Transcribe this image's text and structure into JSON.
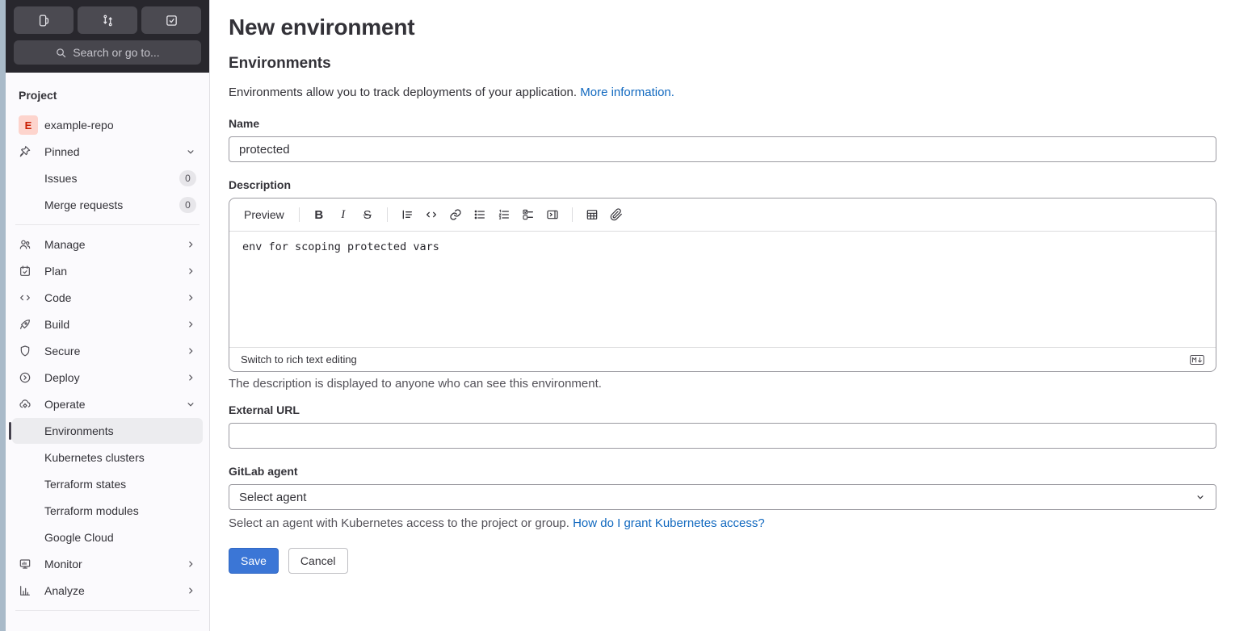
{
  "colors": {
    "accent_blue": "#3b76d6",
    "link_blue": "#1068bf"
  },
  "topbar": {
    "search_placeholder": "Search or go to..."
  },
  "sidebar": {
    "section_label": "Project",
    "project_initial": "E",
    "project_name": "example-repo",
    "pinned_label": "Pinned",
    "pinned_items": [
      {
        "label": "Issues",
        "badge": "0"
      },
      {
        "label": "Merge requests",
        "badge": "0"
      }
    ],
    "menu": [
      {
        "label": "Manage"
      },
      {
        "label": "Plan"
      },
      {
        "label": "Code"
      },
      {
        "label": "Build"
      },
      {
        "label": "Secure"
      },
      {
        "label": "Deploy"
      },
      {
        "label": "Operate"
      }
    ],
    "operate_children": [
      {
        "label": "Environments"
      },
      {
        "label": "Kubernetes clusters"
      },
      {
        "label": "Terraform states"
      },
      {
        "label": "Terraform modules"
      },
      {
        "label": "Google Cloud"
      }
    ],
    "after_operate": [
      {
        "label": "Monitor"
      },
      {
        "label": "Analyze"
      }
    ]
  },
  "main": {
    "title": "New environment",
    "heading": "Environments",
    "intro_text": "Environments allow you to track deployments of your application.",
    "intro_link": "More information.",
    "name_label": "Name",
    "name_value": "protected",
    "description_label": "Description",
    "toolbar_preview": "Preview",
    "description_value": "env for scoping protected vars",
    "editor_footer_link": "Switch to rich text editing",
    "description_help": "The description is displayed to anyone who can see this environment.",
    "external_url_label": "External URL",
    "external_url_value": "",
    "agent_label": "GitLab agent",
    "agent_selected": "Select agent",
    "agent_help": "Select an agent with Kubernetes access to the project or group.",
    "agent_help_link": "How do I grant Kubernetes access?",
    "save_label": "Save",
    "cancel_label": "Cancel"
  }
}
